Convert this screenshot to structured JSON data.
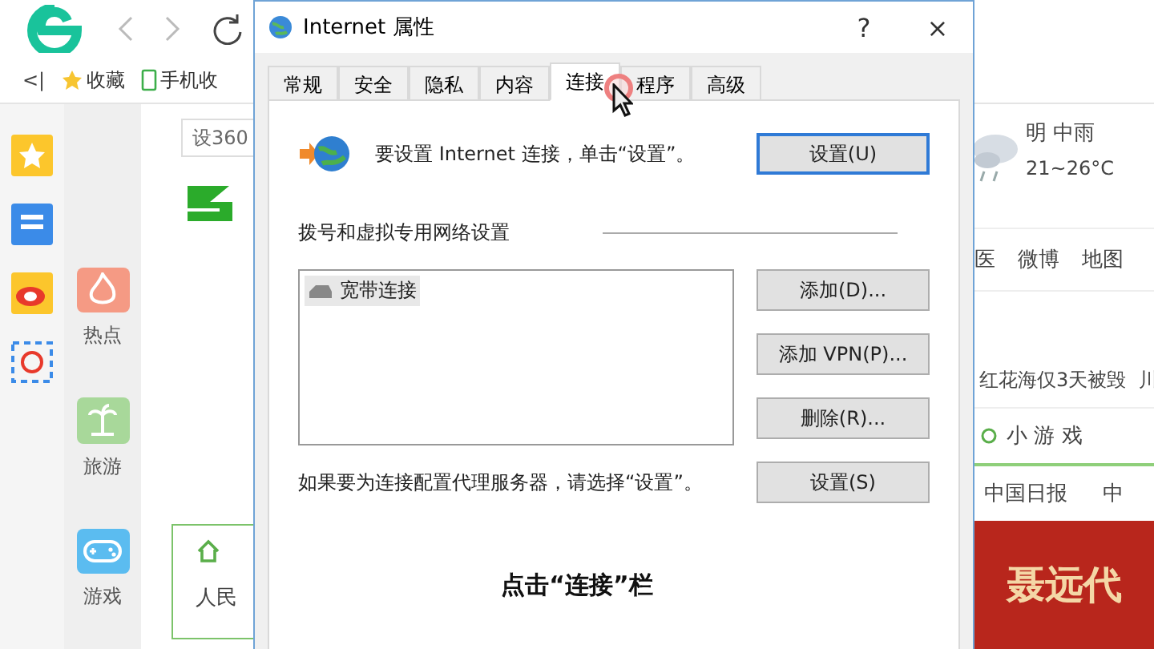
{
  "browser": {
    "bookmarks_bar": {
      "collapse": "<|",
      "items": [
        {
          "label": "收藏"
        },
        {
          "label": "手机收"
        }
      ]
    },
    "search": {
      "value": "设360"
    },
    "side_apps": [
      {
        "label": "热点",
        "color": "#f59a84"
      },
      {
        "label": "旅游",
        "color": "#a8d89a"
      },
      {
        "label": "游戏",
        "color": "#5bbcf0"
      }
    ],
    "weather": {
      "condition": "明 中雨",
      "temperature": "21~26°C"
    },
    "nav_links": [
      "医",
      "微博",
      "地图"
    ],
    "headline": "红花海仅3天被毁",
    "headline_more": "川",
    "games_title": "小 游 戏",
    "site_links": [
      "中国日报",
      "中"
    ],
    "panel_text": "人民",
    "banner": "聂远代"
  },
  "dialog": {
    "title": "Internet 属性",
    "help": "?",
    "close": "×",
    "tabs": [
      {
        "label": "常规",
        "selected": false
      },
      {
        "label": "安全",
        "selected": false
      },
      {
        "label": "隐私",
        "selected": false
      },
      {
        "label": "内容",
        "selected": false
      },
      {
        "label": "连接",
        "selected": true
      },
      {
        "label": "程序",
        "selected": false
      },
      {
        "label": "高级",
        "selected": false
      }
    ],
    "intro": "要设置 Internet 连接，单击“设置”。",
    "setup_button": "设置(U)",
    "section_title": "拨号和虚拟专用网络设置",
    "connections": [
      {
        "name": "宽带连接",
        "selected": true
      }
    ],
    "side_buttons": [
      "添加(D)...",
      "添加 VPN(P)...",
      "删除(R)..."
    ],
    "proxy_text": "如果要为连接配置代理服务器，请选择“设置”。",
    "proxy_button": "设置(S)"
  },
  "caption": "点击“连接”栏"
}
